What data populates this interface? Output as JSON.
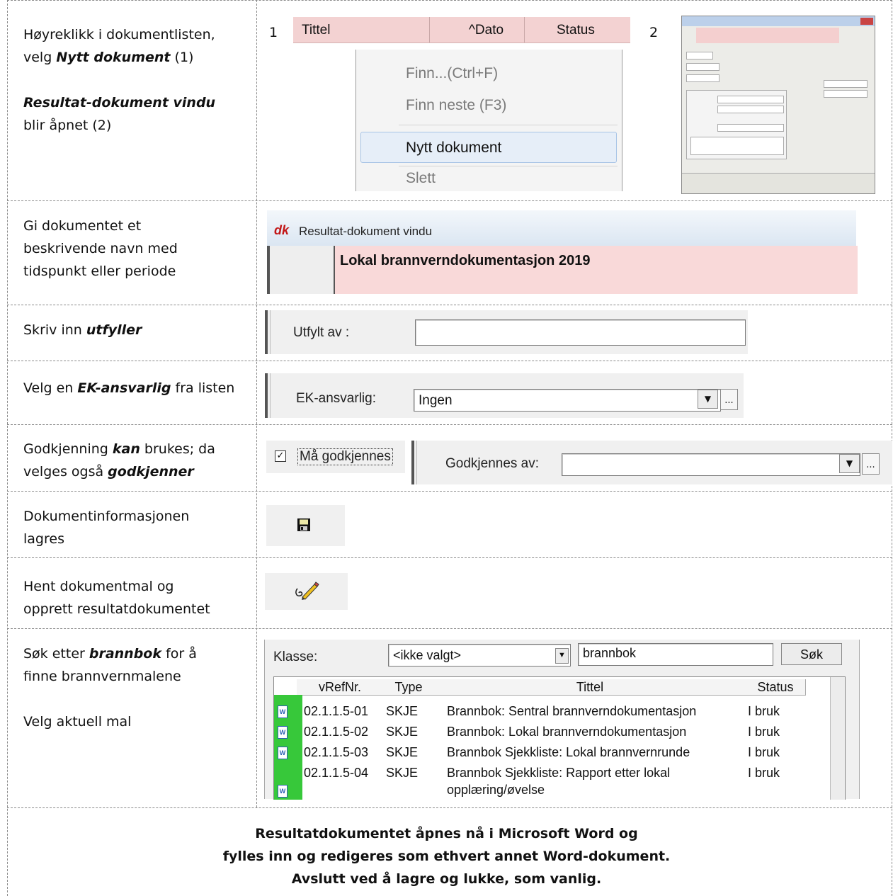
{
  "rows": [
    {
      "left_lines": [
        "Høyreklikk i dokumentlisten,",
        "velg ",
        "Nytt dokument",
        " (1)",
        "Resultat-dokument vindu",
        "blir åpnet (2)"
      ],
      "marker_1": "1",
      "marker_2": "2",
      "list_header": {
        "col1": "Tittel",
        "col2": "^Dato",
        "col3": "Status"
      },
      "context_menu": [
        "Finn...(Ctrl+F)",
        "Finn neste (F3)",
        "Nytt dokument",
        "Slett"
      ]
    },
    {
      "left_lines": [
        "Gi dokumentet et",
        "beskrivende navn med",
        "tidspunkt eller periode"
      ],
      "window_logo": "dk",
      "window_title": "Resultat-dokument vindu",
      "document_title": "Lokal brannverndokumentasjon 2019"
    },
    {
      "left_prefix": "Skriv inn ",
      "left_em": "utfyller",
      "field_label": "Utfylt av :",
      "field_value": ""
    },
    {
      "left_prefix": "Velg en ",
      "left_em": "EK-ansvarlig",
      "left_suffix": " fra listen",
      "field_label": "EK-ansvarlig:",
      "field_value": "Ingen",
      "more_button": "..."
    },
    {
      "left_a": "Godkjenning ",
      "left_a_em": "kan",
      "left_a_suffix": " brukes; da",
      "left_b": "velges også ",
      "left_b_em": "godkjenner",
      "checkbox_label": "Må godkjennes",
      "checkbox_checked": true,
      "field_label": "Godkjennes av:",
      "field_value": "",
      "more_button": "..."
    },
    {
      "left_lines": [
        "Dokumentinformasjonen",
        "lagres"
      ],
      "icon": "save-icon"
    },
    {
      "left_lines": [
        "Hent dokumentmal og",
        "opprett resultatdokumentet"
      ],
      "icon": "edit-document-icon"
    },
    {
      "left_a": "Søk etter ",
      "left_a_em": "brannbok",
      "left_a_suffix": " for å",
      "left_b": "finne brannvernmalene",
      "left_c": "Velg aktuell mal",
      "search": {
        "class_label": "Klasse:",
        "class_value": "<ikke valgt>",
        "query": "brannbok",
        "button": "Søk",
        "columns": [
          "vRefNr.",
          "Type",
          "Tittel",
          "Status"
        ],
        "results": [
          {
            "ref": "02.1.1.5-01",
            "type": "SKJE",
            "title": "Brannbok: Sentral brannverndokumentasjon",
            "status": "I bruk"
          },
          {
            "ref": "02.1.1.5-02",
            "type": "SKJE",
            "title": "Brannbok: Lokal brannverndokumentasjon",
            "status": "I bruk"
          },
          {
            "ref": "02.1.1.5-03",
            "type": "SKJE",
            "title": "Brannbok Sjekkliste: Lokal brannvernrunde",
            "status": "I bruk"
          },
          {
            "ref": "02.1.1.5-04",
            "type": "SKJE",
            "title": "Brannbok Sjekkliste: Rapport etter lokal",
            "title2": "opplæring/øvelse",
            "status": "I bruk"
          }
        ]
      }
    }
  ],
  "footer": [
    "Resultatdokumentet åpnes nå i Microsoft Word og",
    "fylles inn og redigeres som ethvert annet Word-dokument.",
    "Avslutt ved å lagre og lukke, som vanlig."
  ],
  "colors": {
    "pink": "#f9d9d9",
    "header_pink": "#f3d2d2",
    "word_green": "#37c83a",
    "dashed": "#8a8a8a"
  }
}
